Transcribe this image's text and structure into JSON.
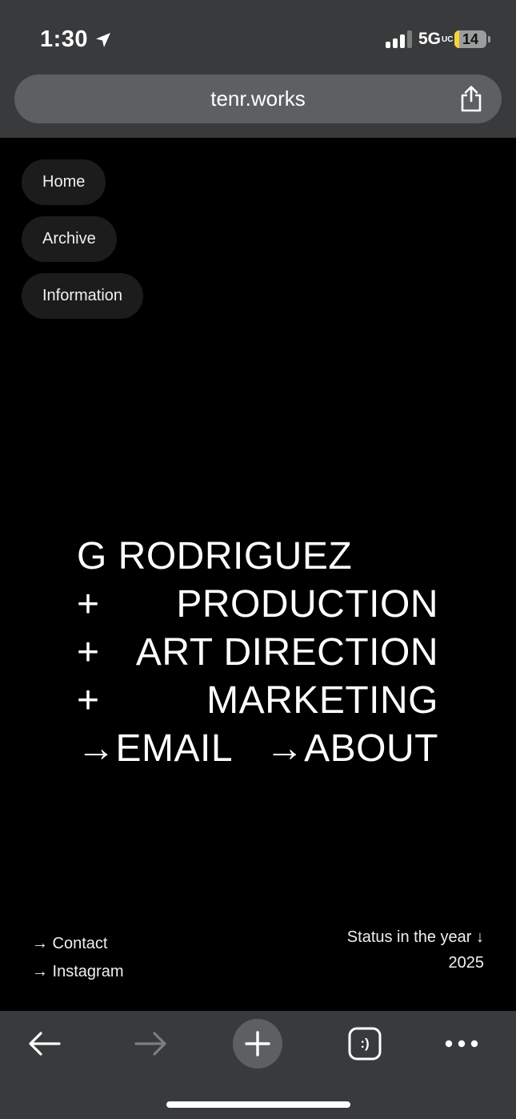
{
  "status_bar": {
    "time": "1:30",
    "network": "5G",
    "network_suffix": "UC",
    "battery": "14",
    "battery_level": 0.14
  },
  "browser": {
    "url": "tenr.works"
  },
  "nav": {
    "items": [
      "Home",
      "Archive",
      "Information"
    ]
  },
  "hero": {
    "line1": "G RODRIGUEZ",
    "plus": "+",
    "line2": "PRODUCTION",
    "line3": "ART DIRECTION",
    "line4": "MARKETING",
    "email": "→EMAIL",
    "about": "→ABOUT"
  },
  "footer": {
    "contact": "→ Contact",
    "instagram": "→ Instagram",
    "status_label": "Status in the year ↓",
    "year": "2025"
  },
  "toolbar": {
    "tabs_label": ":)"
  },
  "colors": {
    "chrome": "#383a3c",
    "pill": "#1c1c1c",
    "background": "#000000"
  }
}
